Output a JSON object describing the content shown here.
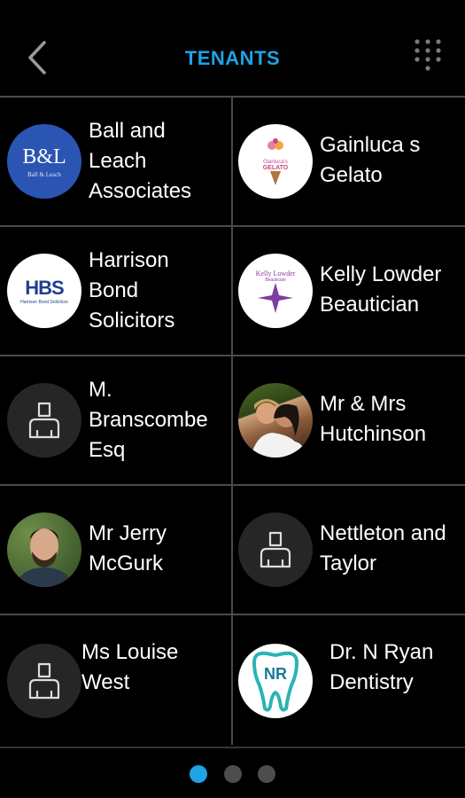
{
  "header": {
    "title": "TENANTS",
    "back_icon": "chevron-left-icon",
    "menu_icon": "grid-dots-icon"
  },
  "colors": {
    "accent": "#1da3e6",
    "background": "#000000",
    "divider": "#4a4a4a",
    "dot_inactive": "#4d4d4d"
  },
  "tenants": [
    {
      "name_lines": [
        "Ball and",
        "Leach",
        "Associates"
      ],
      "logo": "B&L",
      "logo_sub": "Ball & Leach"
    },
    {
      "name_lines": [
        "Gainluca s",
        "Gelato"
      ],
      "logo": "GELATO",
      "logo_sub": "Gianluca's"
    },
    {
      "name_lines": [
        "Harrison",
        "Bond",
        "Solicitors"
      ],
      "logo": "HBS",
      "logo_sub": "Harrison Bond Solicitors"
    },
    {
      "name_lines": [
        "Kelly Lowder",
        "Beautician"
      ],
      "logo": "Kelly Lowder",
      "logo_sub": "Beautician"
    },
    {
      "name_lines": [
        "M.",
        "Branscombe",
        "Esq"
      ]
    },
    {
      "name_lines": [
        "Mr & Mrs",
        "Hutchinson"
      ]
    },
    {
      "name_lines": [
        "Mr Jerry",
        "McGurk"
      ]
    },
    {
      "name_lines": [
        "Nettleton and",
        "Taylor"
      ]
    },
    {
      "name_lines": [
        "Ms Louise",
        "West"
      ]
    },
    {
      "name_lines": [
        "Dr. N Ryan",
        "Dentistry"
      ],
      "logo": "NR"
    }
  ],
  "pagination": {
    "pages": 3,
    "current": 1
  }
}
